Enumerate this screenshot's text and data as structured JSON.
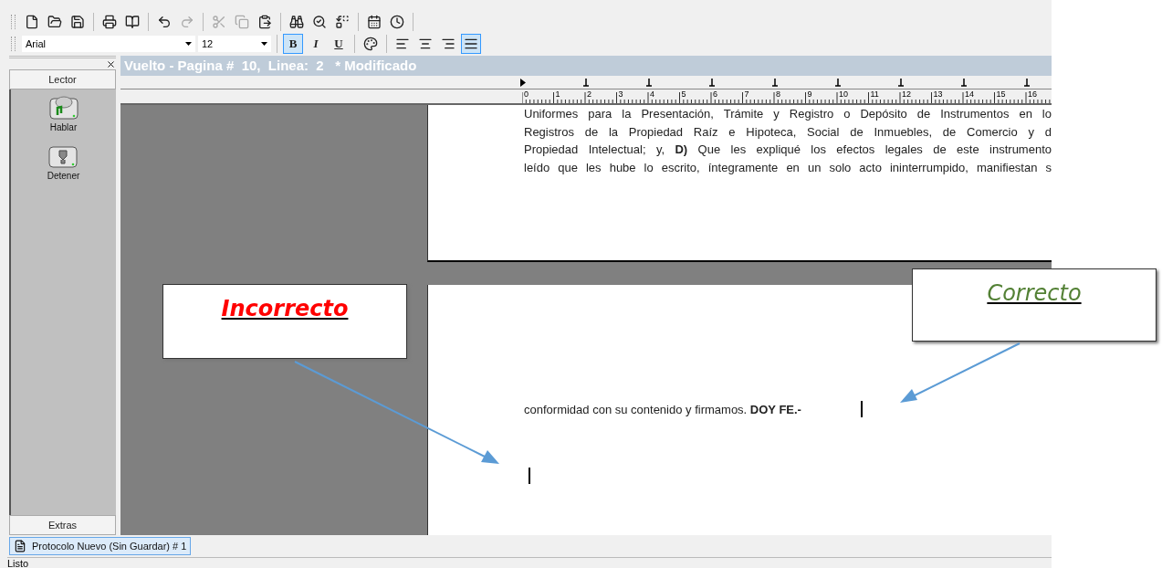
{
  "toolbar": {
    "buttons": [
      {
        "kind": "new",
        "disabled": false
      },
      {
        "kind": "open",
        "disabled": false
      },
      {
        "kind": "save",
        "disabled": false
      },
      {
        "kind": "sep"
      },
      {
        "kind": "print",
        "disabled": false
      },
      {
        "kind": "preview",
        "disabled": false
      },
      {
        "kind": "sep"
      },
      {
        "kind": "undo",
        "disabled": false
      },
      {
        "kind": "redo",
        "disabled": true
      },
      {
        "kind": "sep"
      },
      {
        "kind": "cut",
        "disabled": true
      },
      {
        "kind": "copy",
        "disabled": true
      },
      {
        "kind": "paste",
        "disabled": false
      },
      {
        "kind": "sep"
      },
      {
        "kind": "find",
        "disabled": false
      },
      {
        "kind": "findnext",
        "disabled": false
      },
      {
        "kind": "replace",
        "disabled": false
      },
      {
        "kind": "sep"
      },
      {
        "kind": "date",
        "disabled": false
      },
      {
        "kind": "time",
        "disabled": false
      },
      {
        "kind": "sep"
      }
    ]
  },
  "format_bar": {
    "font": "Arial",
    "size": "12",
    "style_buttons": [
      {
        "label": "B",
        "kind": "bold",
        "selected": true
      },
      {
        "label": "I",
        "kind": "italic",
        "selected": false
      },
      {
        "label": "U",
        "kind": "underline",
        "selected": false
      }
    ],
    "align_buttons": [
      {
        "kind": "left",
        "selected": false
      },
      {
        "kind": "center",
        "selected": false
      },
      {
        "kind": "right",
        "selected": false
      },
      {
        "kind": "justify",
        "selected": true
      }
    ]
  },
  "sidebar": {
    "header": "Lector",
    "items": [
      {
        "label": "Hablar",
        "kind": "speak"
      },
      {
        "label": "Detener",
        "kind": "stop"
      }
    ],
    "footer": "Extras"
  },
  "document": {
    "title": "Vuelto - Pagina #  10,  Linea:  2   * Modificado",
    "ruler": [
      "0",
      "1",
      "2",
      "3",
      "4",
      "5",
      "6",
      "7",
      "8",
      "9",
      "10",
      "11",
      "12",
      "13",
      "14",
      "15",
      "16"
    ],
    "page_1_lines": [
      "Uniformes para la Presentación, Trámite y Registro o Depósito de Instrumentos en lo",
      "Registros de la Propiedad Raíz e Hipoteca, Social de Inmuebles, de Comercio y d",
      "Propiedad Intelectual; y, **D)** Que les expliqué los efectos legales de este instrumento",
      "leído que les hube lo escrito, íntegramente en un solo acto ininterrumpido, manifiestan s"
    ],
    "page_2_line": "conformidad con su contenido y firmamos. **DOY FE.-**"
  },
  "annotations": [
    {
      "text": "Incorrecto",
      "color": "#ff0000"
    },
    {
      "text": "Correcto",
      "color": "#538135"
    }
  ],
  "tabs": [
    {
      "label": "Protocolo Nuevo (Sin Guardar) # 1",
      "selected": true
    }
  ],
  "status_bar": "Listo"
}
